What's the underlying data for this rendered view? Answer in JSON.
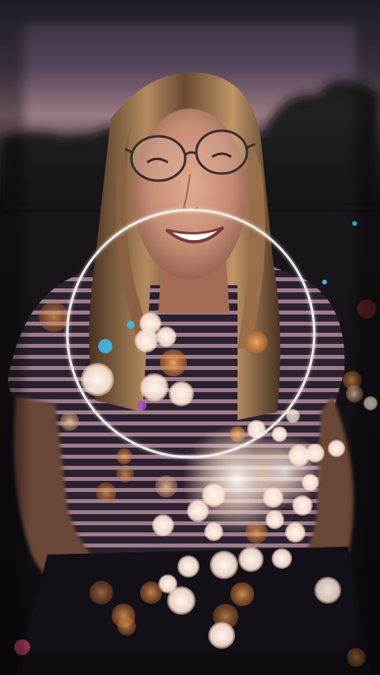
{
  "scene": {
    "description_icon": "bokeh-portrait-image",
    "overlay": "circular-ring-visualizer"
  },
  "colors": {
    "sky_top": "#3b3346",
    "sky_mid": "#6e5565",
    "horizon_glow": "#a67f86",
    "ground": "#121014",
    "hair": "#7a5538",
    "hair_highlight": "#c49a6c",
    "skin": "#c58c74",
    "shirt_dark": "#2b2130",
    "shirt_stripe": "#b48c9a",
    "ring": "#f3ecea",
    "bokeh_warm": "#f0b37a",
    "bokeh_white": "#ffe9dc",
    "bokeh_orange": "#e08a3a",
    "bokeh_cyan": "#3fb9e0"
  }
}
